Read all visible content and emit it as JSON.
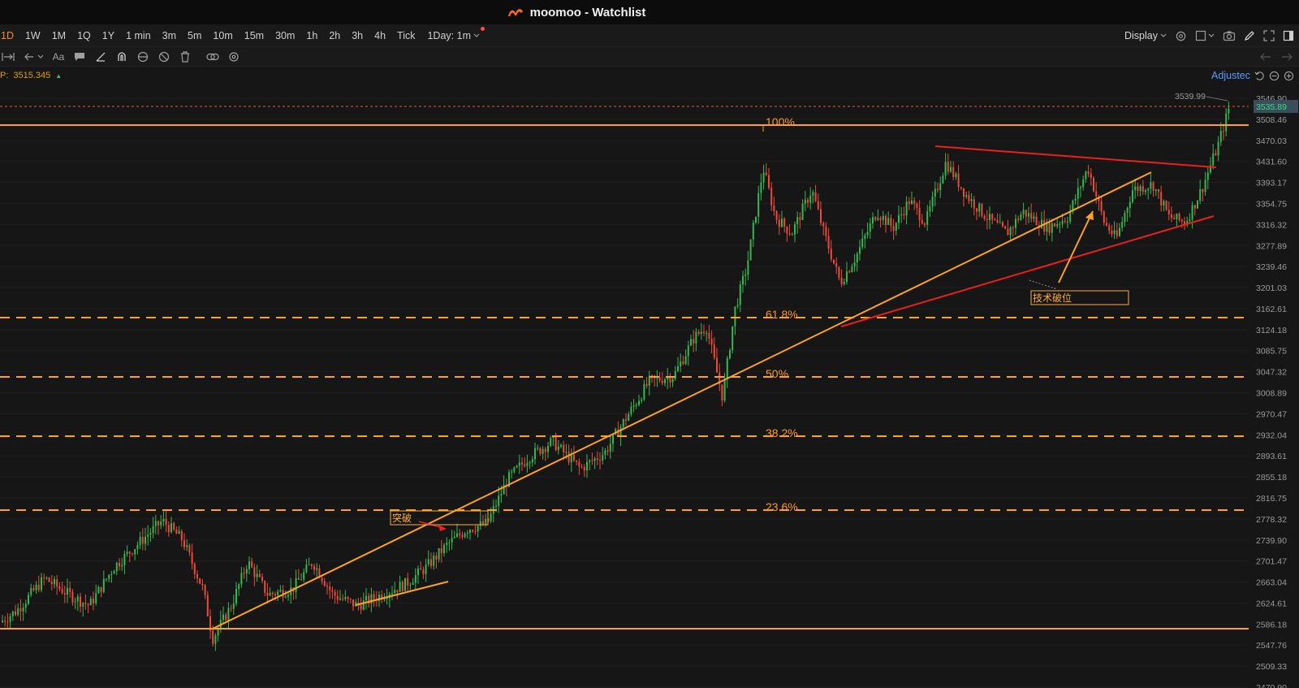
{
  "window": {
    "title": "moomoo - Watchlist"
  },
  "timeframes": [
    {
      "label": "1D",
      "active": true
    },
    {
      "label": "1W"
    },
    {
      "label": "1M"
    },
    {
      "label": "1Q"
    },
    {
      "label": "1Y"
    },
    {
      "label": "1 min"
    },
    {
      "label": "3m"
    },
    {
      "label": "5m"
    },
    {
      "label": "10m"
    },
    {
      "label": "15m"
    },
    {
      "label": "30m"
    },
    {
      "label": "1h"
    },
    {
      "label": "2h"
    },
    {
      "label": "3h"
    },
    {
      "label": "4h"
    },
    {
      "label": "Tick"
    }
  ],
  "interval_select": {
    "label": "1Day: 1m"
  },
  "display_menu": {
    "label": "Display"
  },
  "info": {
    "label": "P:",
    "value": "3515.345"
  },
  "adjusted": {
    "label": "Adjustec"
  },
  "chart": {
    "price_axis": [
      "3546.90",
      "3508.46",
      "3470.03",
      "3431.60",
      "3393.17",
      "3354.75",
      "3316.32",
      "3277.89",
      "3239.46",
      "3201.03",
      "3162.61",
      "3124.18",
      "3085.75",
      "3047.32",
      "3008.89",
      "2970.47",
      "2932.04",
      "2893.61",
      "2855.18",
      "2816.75",
      "2778.32",
      "2739.90",
      "2701.47",
      "2663.04",
      "2624.61",
      "2586.18",
      "2547.76",
      "2509.33",
      "2470.90"
    ],
    "last_price": "3535.89",
    "high_marker": "3539.99",
    "fib_levels": [
      {
        "label": "100%",
        "price": 3500
      },
      {
        "label": "61.8%",
        "price": 3124
      },
      {
        "label": "50%",
        "price": 3009
      },
      {
        "label": "38.2%",
        "price": 2894
      },
      {
        "label": "23.6%",
        "price": 2753
      }
    ],
    "support_price": 2541,
    "notes": [
      {
        "label": "突破"
      },
      {
        "label": "技术破位"
      }
    ]
  }
}
